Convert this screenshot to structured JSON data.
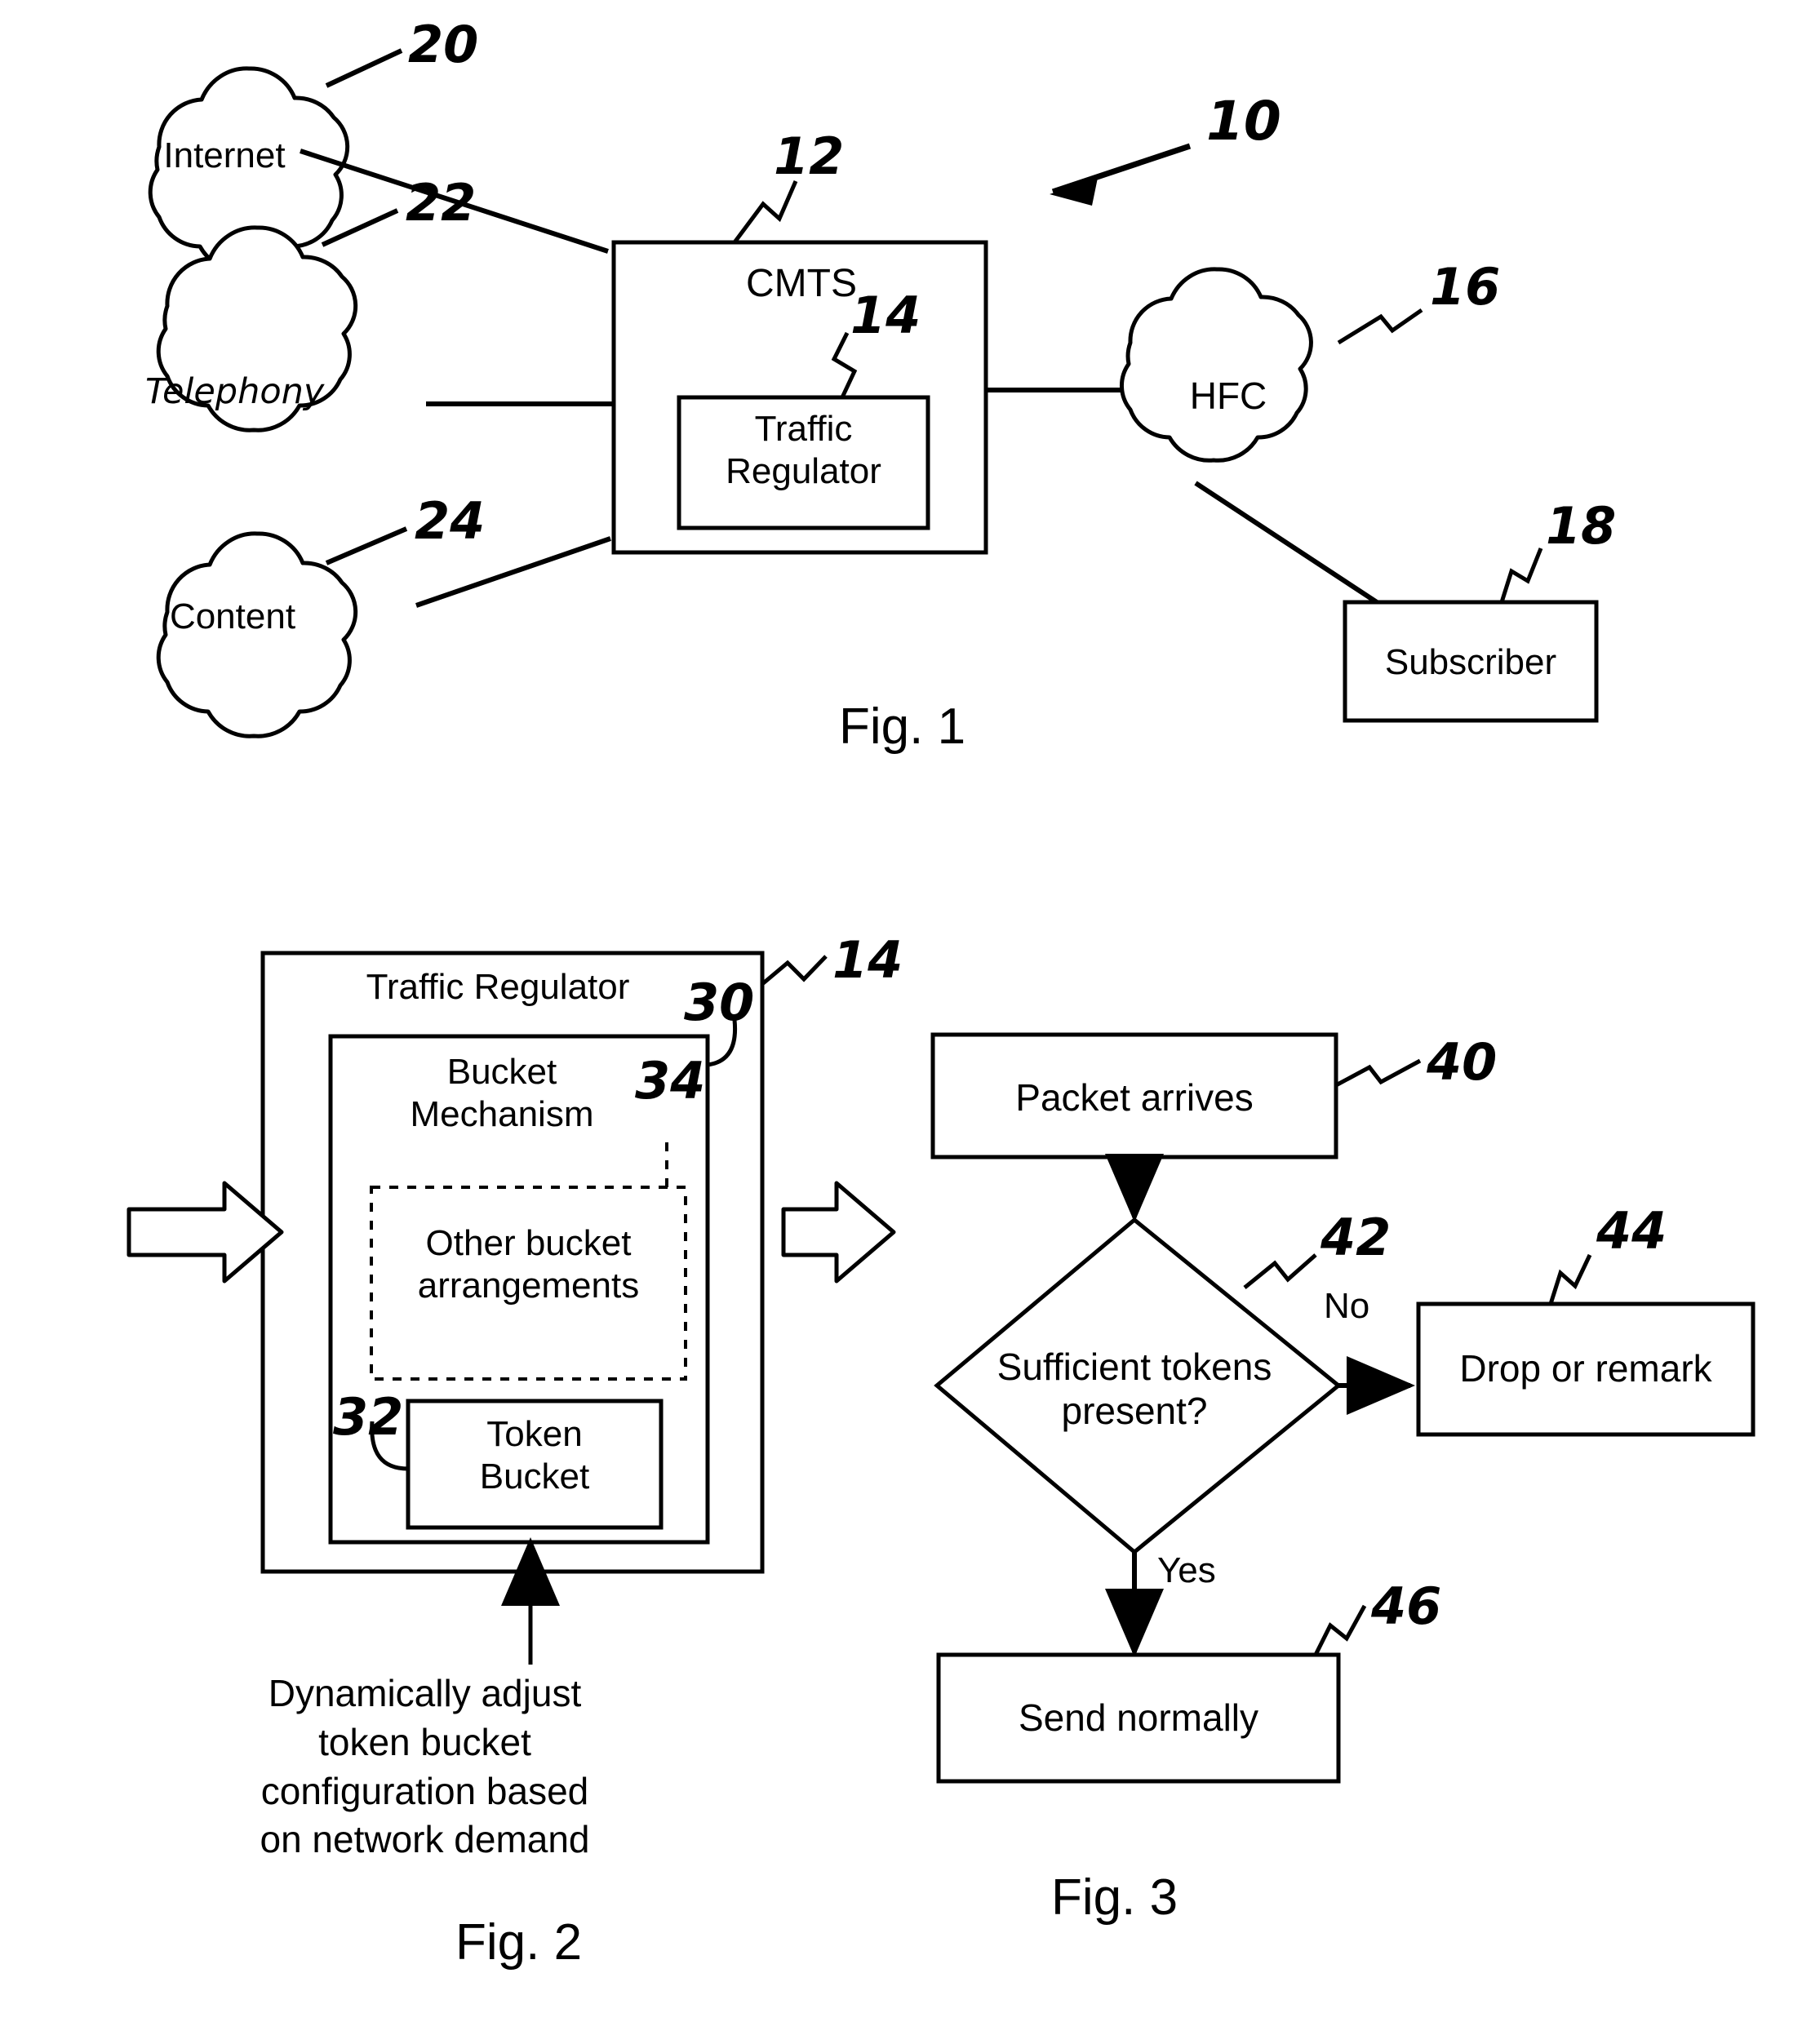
{
  "document": {
    "type": "patent-drawing-sheet",
    "figures": [
      "Fig. 1",
      "Fig. 2",
      "Fig. 3"
    ]
  },
  "fig1": {
    "caption": "Fig. 1",
    "system_ref": "10",
    "nodes": {
      "internet": {
        "label": "Internet",
        "ref": "20",
        "shape": "cloud"
      },
      "telephony": {
        "label": "Telephony",
        "ref": "22",
        "shape": "cloud"
      },
      "content": {
        "label": "Content",
        "ref": "24",
        "shape": "cloud"
      },
      "cmts": {
        "label": "CMTS",
        "ref": "12",
        "shape": "box"
      },
      "traffic_regulator": {
        "label": "Traffic\nRegulator",
        "ref": "14",
        "shape": "box"
      },
      "hfc": {
        "label": "HFC",
        "ref": "16",
        "shape": "cloud"
      },
      "subscriber": {
        "label": "Subscriber",
        "ref": "18",
        "shape": "box"
      }
    }
  },
  "fig2": {
    "caption": "Fig. 2",
    "nodes": {
      "traffic_regulator": {
        "label": "Traffic Regulator",
        "ref": "14",
        "shape": "box"
      },
      "bucket_mechanism": {
        "label": "Bucket\nMechanism",
        "ref": "30",
        "shape": "box"
      },
      "other_bucket": {
        "label": "Other bucket\narrangements",
        "ref": "34",
        "shape": "dashed-box"
      },
      "token_bucket": {
        "label": "Token\nBucket",
        "ref": "32",
        "shape": "box"
      }
    },
    "annotation": "Dynamically adjust\ntoken bucket\nconfiguration based\non network demand",
    "arrows": {
      "input": "block-arrow-right",
      "output": "block-arrow-right"
    }
  },
  "fig3": {
    "caption": "Fig. 3",
    "nodes": {
      "packet_arrives": {
        "label": "Packet arrives",
        "ref": "40",
        "shape": "box"
      },
      "sufficient_tokens": {
        "label": "Sufficient tokens\npresent?",
        "ref": "42",
        "shape": "diamond"
      },
      "drop_or_remark": {
        "label": "Drop or remark",
        "ref": "44",
        "shape": "box"
      },
      "send_normally": {
        "label": "Send normally",
        "ref": "46",
        "shape": "box"
      }
    },
    "edges": {
      "no_label": "No",
      "yes_label": "Yes"
    }
  },
  "colors": {
    "ink": "#000000",
    "paper": "#ffffff"
  }
}
